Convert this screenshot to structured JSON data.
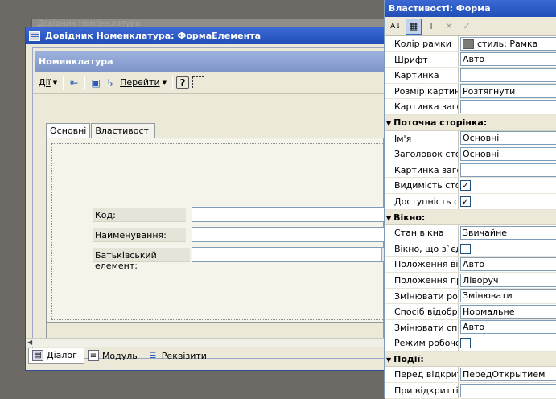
{
  "background_window": {
    "title": "Довідник Номенклатура"
  },
  "form_window": {
    "title": "Довідник Номенклатура: ФормаЕлемента",
    "header": "Номенклатура",
    "toolbar": {
      "actions_label": "Дії",
      "goto_label": "Перейти"
    },
    "tabs": [
      "Основні",
      "Властивості"
    ],
    "fields": {
      "code_label": "Код:",
      "name_label": "Найменування:",
      "parent_label": "Батьківський елемент:"
    },
    "bottom_tabs": [
      "Діалог",
      "Модуль",
      "Реквізити"
    ]
  },
  "properties": {
    "title": "Властивості: Форма",
    "rows_top": [
      {
        "name": "Колір рамки",
        "value": "стиль: Рамка"
      },
      {
        "name": "Шрифт",
        "value": "Авто"
      },
      {
        "name": "Картинка",
        "value": ""
      },
      {
        "name": "Розмір картинки",
        "value": "Розтягнути"
      },
      {
        "name": "Картинка заголовка",
        "value": ""
      }
    ],
    "cat_page": "Поточна сторінка:",
    "rows_page": [
      {
        "name": "Ім'я",
        "value": "Основні"
      },
      {
        "name": "Заголовок сторінки",
        "value": "Основні"
      },
      {
        "name": "Картинка заголовка",
        "value": ""
      },
      {
        "name": "Видимість сторінки",
        "value": "✓"
      },
      {
        "name": "Доступність сторінки",
        "value": "✓"
      }
    ],
    "cat_window": "Вікно:",
    "rows_window": [
      {
        "name": "Стан вікна",
        "value": "Звичайне"
      },
      {
        "name": "Вікно, що з`єднується",
        "value": ""
      },
      {
        "name": "Положення вікна",
        "value": "Авто"
      },
      {
        "name": "Положення прикріпленого",
        "value": "Ліворуч"
      },
      {
        "name": "Змінювати розмір",
        "value": "Змінювати"
      },
      {
        "name": "Спосіб відображення",
        "value": "Нормальне"
      },
      {
        "name": "Змінювати спосіб",
        "value": "Авто"
      },
      {
        "name": "Режим робочого столу",
        "value": ""
      }
    ],
    "cat_events": "Події:",
    "rows_events": [
      {
        "name": "Перед відкриттям",
        "value": "ПередОткрытием"
      },
      {
        "name": "При відкритті",
        "value": ""
      }
    ]
  }
}
